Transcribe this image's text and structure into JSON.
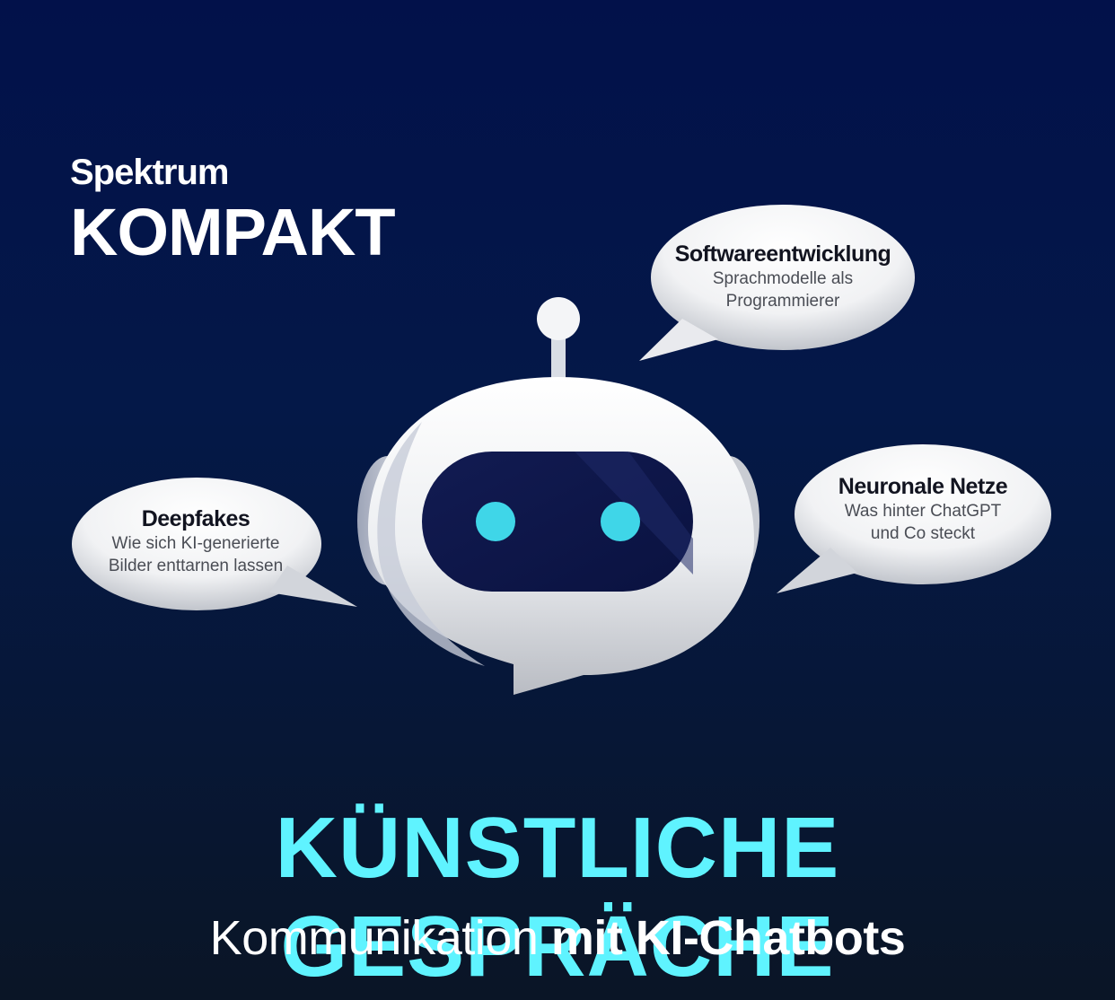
{
  "brand": {
    "top": "Spektrum",
    "main": "KOMPAKT"
  },
  "bubbles": {
    "software": {
      "title": "Softwareentwicklung",
      "line1": "Sprachmodelle als",
      "line2": "Programmierer"
    },
    "deepfakes": {
      "title": "Deepfakes",
      "line1": "Wie sich KI-generierte",
      "line2": "Bilder enttarnen lassen"
    },
    "neuronal": {
      "title": "Neuronale Netze",
      "line1": "Was hinter ChatGPT",
      "line2": "und Co steckt"
    }
  },
  "headline": "KÜNSTLICHE GESPRÄCHE",
  "subline": {
    "regular": "Kommunikation ",
    "bold": "mit KI-Chatbots"
  },
  "colors": {
    "accent": "#5ff3ff",
    "eyes": "#3fd6e8",
    "background": "#02114a"
  },
  "icons": {
    "mascot": "robot-chatbot-icon"
  }
}
